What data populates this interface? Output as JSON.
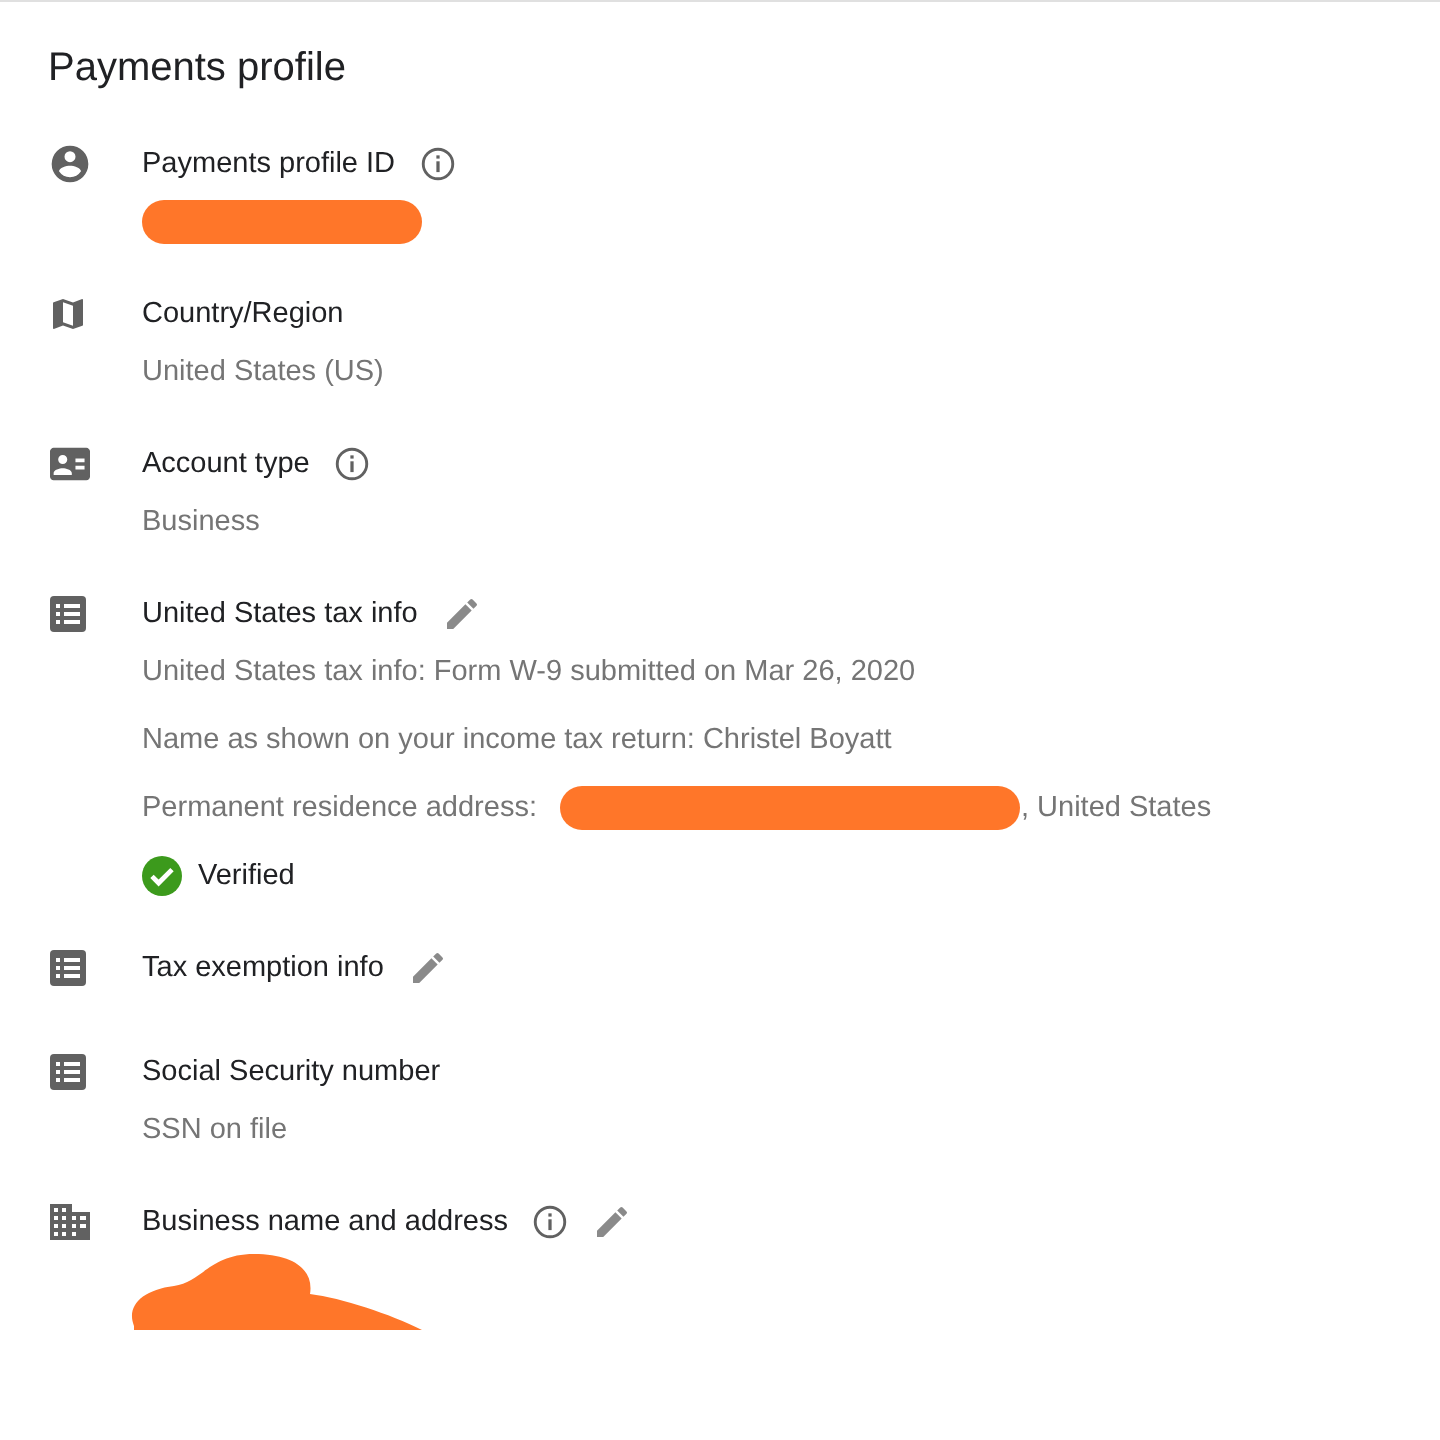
{
  "title": "Payments profile",
  "sections": [
    {
      "kind": "person",
      "title": "Payments profile ID",
      "info": true,
      "edit": false,
      "lines": [
        {
          "kind": "redacted"
        }
      ]
    },
    {
      "kind": "map",
      "title": "Country/Region",
      "info": false,
      "edit": false,
      "lines": [
        {
          "kind": "plain",
          "text": "United States (US)"
        }
      ]
    },
    {
      "kind": "card",
      "title": "Account type",
      "info": true,
      "edit": false,
      "lines": [
        {
          "kind": "plain",
          "text": "Business"
        }
      ]
    },
    {
      "kind": "list",
      "title": "United States tax info",
      "info": false,
      "edit": true,
      "lines": [
        {
          "kind": "plain",
          "text": "United States tax info: Form W-9 submitted on Mar 26, 2020"
        },
        {
          "kind": "plain",
          "text": "Name as shown on your income tax return: Christel Boyatt"
        },
        {
          "kind": "redacted-pair",
          "label": "Permanent residence address:",
          "suffix": ", United States"
        },
        {
          "kind": "verified",
          "text": "Verified"
        }
      ]
    },
    {
      "kind": "list",
      "title": "Tax exemption info",
      "info": false,
      "edit": true
    },
    {
      "kind": "list",
      "title": "Social Security number",
      "info": false,
      "edit": false,
      "lines": [
        {
          "kind": "plain",
          "text": "SSN on file"
        }
      ]
    },
    {
      "kind": "building",
      "title": "Business name and address",
      "info": true,
      "edit": true,
      "lines": [
        {
          "kind": "scribble"
        }
      ]
    }
  ]
}
